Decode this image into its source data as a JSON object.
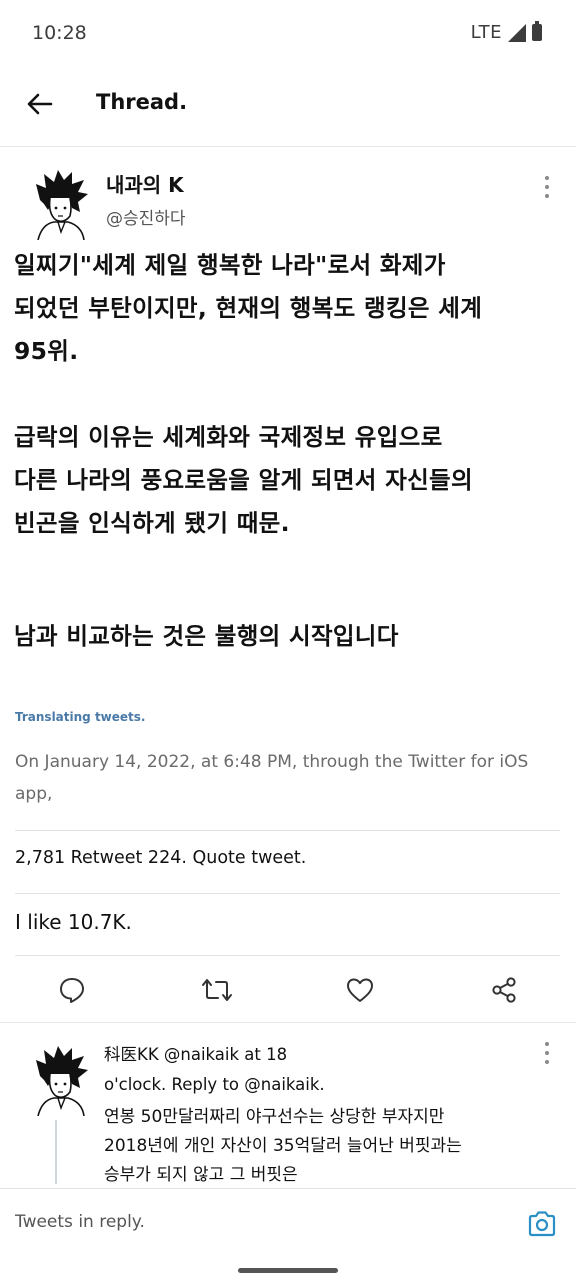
{
  "status_bar": {
    "time": "10:28",
    "network": "LTE"
  },
  "header": {
    "title": "Thread."
  },
  "tweet": {
    "author_name": "내과의 K",
    "author_handle": "@승진하다",
    "text_lines": [
      "일찌기\"세계 제일 행복한 나라\"로서 화제가",
      "되었던 부탄이지만, 현재의 행복도 랭킹은 세계",
      "95위.",
      "급락의 이유는 세계화와 국제정보 유입으로",
      "다른 나라의 풍요로움을 알게 되면서 자신들의",
      "빈곤을 인식하게 됐기 때문.",
      "남과 비교하는 것은 불행의 시작입니다"
    ],
    "translating_label": "Translating tweets.",
    "timestamp": "On January 14, 2022, at 6:48 PM, through the Twitter for iOS app,",
    "stats": "2,781 Retweet 224. Quote tweet.",
    "likes": "I like 10.7K."
  },
  "actions": {
    "reply_icon": "comment-icon",
    "retweet_icon": "retweet-icon",
    "like_icon": "heart-icon",
    "share_icon": "share-icon"
  },
  "reply": {
    "meta_line1": "科医KK @naikaik at 18",
    "meta_line2": "o'clock. Reply to @naikaik.",
    "text_lines": [
      "연봉 50만달러짜리 야구선수는 상당한 부자지만",
      "2018년에 개인 자산이 35억달러 늘어난 버핏과는",
      "승부가 되지 않고 그 버핏은"
    ]
  },
  "composer": {
    "placeholder": "Tweets in reply."
  },
  "colors": {
    "accent": "#4a7aa8",
    "camera": "#2a8fc4",
    "muted": "#6b6b6b"
  }
}
